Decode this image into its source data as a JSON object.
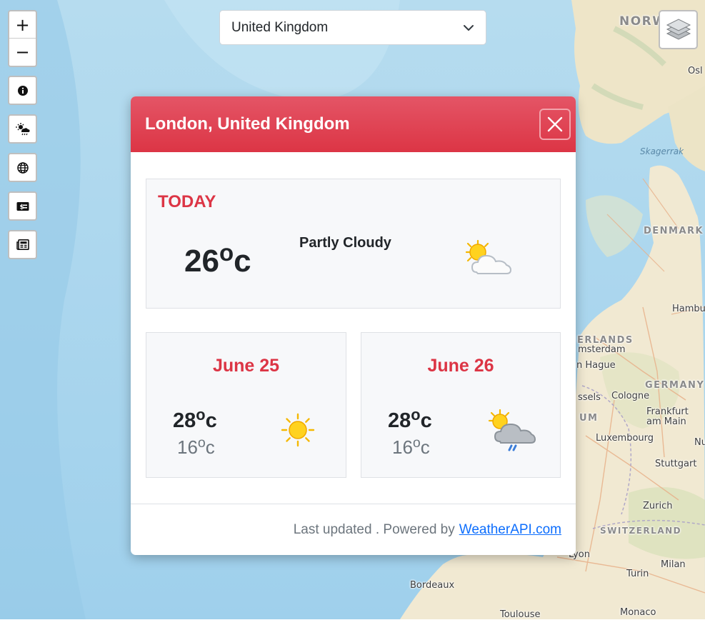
{
  "map": {
    "labels": {
      "norway": "NORW",
      "oslo": "Osl",
      "skagerrak": "Skagerrak",
      "denmark": "DENMARK",
      "hamburg": "Hambu",
      "netherlands": "ERLANDS",
      "amsterdam": "msterdam",
      "hague": "n Hague",
      "brussels": "ssels",
      "cologne": "Cologne",
      "germany": "GERMANY",
      "belgium": "UM",
      "frankfurt": "Frankfurt am Main",
      "luxembourg": "Luxembourg",
      "nu": "Nu",
      "stuttgart": "Stuttgart",
      "zurich": "Zurich",
      "switzerland": "SWITZERLAND",
      "lyon": "Lyon",
      "milan": "Milan",
      "turin": "Turin",
      "bordeaux": "Bordeaux",
      "toulouse": "Toulouse",
      "monaco": "Monaco"
    }
  },
  "controls": {
    "zoom_in": "+",
    "zoom_out": "−",
    "buttons": [
      "info-icon",
      "weather-icon",
      "globe-icon",
      "currency-icon",
      "news-icon"
    ],
    "layers": "layers-icon"
  },
  "country_select": {
    "selected": "United Kingdom"
  },
  "modal": {
    "title": "London, United Kingdom",
    "today": {
      "label": "TODAY",
      "temp": "26",
      "unit": "c",
      "condition": "Partly Cloudy",
      "icon": "partly-cloudy-icon"
    },
    "forecast": [
      {
        "date": "June 25",
        "max": "28",
        "min": "16",
        "unit": "c",
        "icon": "sunny-icon"
      },
      {
        "date": "June 26",
        "max": "28",
        "min": "16",
        "unit": "c",
        "icon": "patchy-rain-icon"
      }
    ],
    "footer": {
      "text": "Last updated . Powered by",
      "link": "WeatherAPI.com"
    }
  },
  "colors": {
    "accent": "#dc3545",
    "header_top": "#e45566",
    "card_bg": "#f7f8fa",
    "link": "#0d6efd",
    "sea": "#a6d0ea",
    "land": "#f2ead3"
  }
}
